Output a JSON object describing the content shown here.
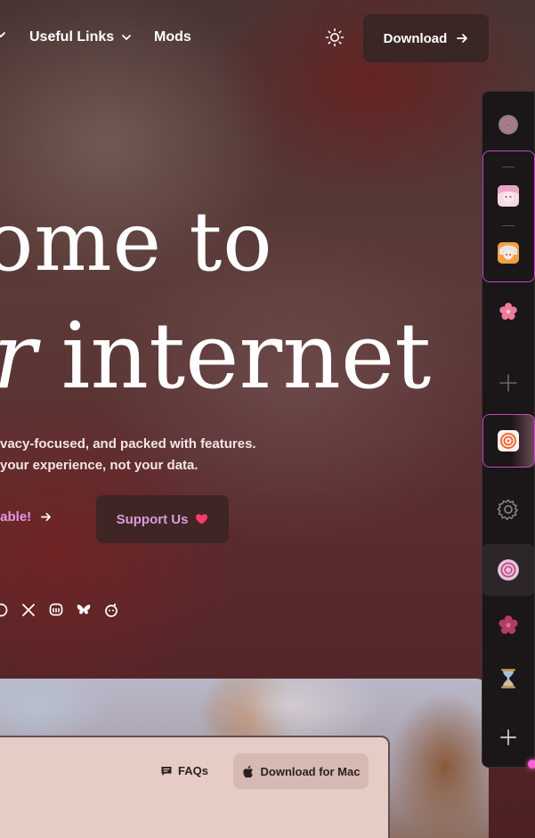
{
  "nav": {
    "useful_links": "Useful Links",
    "mods": "Mods",
    "download": "Download"
  },
  "hero": {
    "line1": "ome to",
    "line2_italic": "r",
    "line2_rest": "internet",
    "subtitle_line1": "vacy-focused, and packed with features.",
    "subtitle_line2": "your experience, not your data.",
    "cta_available": "lable!",
    "cta_support": "Support Us"
  },
  "socials": [
    "github-icon",
    "x-icon",
    "mastodon-icon",
    "bluesky-icon",
    "reddit-icon"
  ],
  "sidebar": {
    "items": [
      "zen-logo-icon",
      "anime-avatar-1",
      "anime-avatar-2",
      "flower-icon",
      "add-icon",
      "spiral-app-icon",
      "settings-icon",
      "zen-logo-icon",
      "flower-icon",
      "hourglass-icon",
      "add-icon"
    ]
  },
  "preview": {
    "faqs": "FAQs",
    "download_mac": "Download for Mac"
  },
  "colors": {
    "accent_pink": "#e39ae6",
    "button_dark": "#3a2624",
    "sidebar_bg": "#1b1617",
    "highlight_border": "#c14ac1"
  }
}
